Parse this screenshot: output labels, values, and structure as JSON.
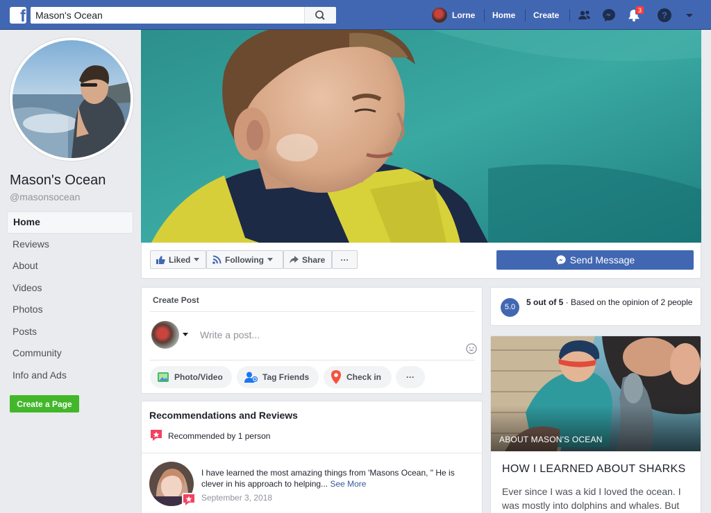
{
  "topbar": {
    "logo": "f",
    "search_value": "Mason's Ocean",
    "profile_name": "Lorne",
    "home_label": "Home",
    "create_label": "Create",
    "notification_count": "3",
    "colors": {
      "bar": "#4267b2",
      "badge": "#fa3e3e"
    }
  },
  "page": {
    "name": "Mason's Ocean",
    "handle": "@masonsocean"
  },
  "left_nav": {
    "items": [
      {
        "label": "Home",
        "active": true
      },
      {
        "label": "Reviews"
      },
      {
        "label": "About"
      },
      {
        "label": "Videos"
      },
      {
        "label": "Photos"
      },
      {
        "label": "Posts"
      },
      {
        "label": "Community"
      },
      {
        "label": "Info and Ads"
      }
    ],
    "create_page_label": "Create a Page"
  },
  "actions": {
    "liked_label": "Liked",
    "following_label": "Following",
    "share_label": "Share",
    "more_label": "···",
    "send_message_label": "Send Message"
  },
  "create_post": {
    "title": "Create Post",
    "placeholder": "Write a post...",
    "photo_video_label": "Photo/Video",
    "tag_friends_label": "Tag Friends",
    "check_in_label": "Check in",
    "more_label": "···"
  },
  "recommendations": {
    "title": "Recommendations and Reviews",
    "count_text": "Recommended by 1 person",
    "review": {
      "text": "I have learned the most amazing things from 'Masons Ocean, \" He is clever in his approach to helping...",
      "see_more": "See More",
      "date": "September 3, 2018"
    }
  },
  "rating": {
    "score": "5.0",
    "summary_bold": "5 out of 5",
    "summary_rest": " · Based on the opinion of 2 people"
  },
  "story": {
    "label": "ABOUT MASON'S OCEAN",
    "title": "HOW I LEARNED ABOUT SHARKS",
    "body": "Ever since I was a kid I loved the ocean. I was mostly into dolphins and whales. But"
  },
  "icons": [
    "facebook-logo-icon",
    "search-icon",
    "friends-icon",
    "messenger-icon",
    "bell-icon",
    "help-icon",
    "dropdown-icon",
    "like-icon",
    "rss-icon",
    "share-icon",
    "photo-icon",
    "tag-icon",
    "location-pin-icon",
    "emoji-icon",
    "review-star-icon"
  ]
}
